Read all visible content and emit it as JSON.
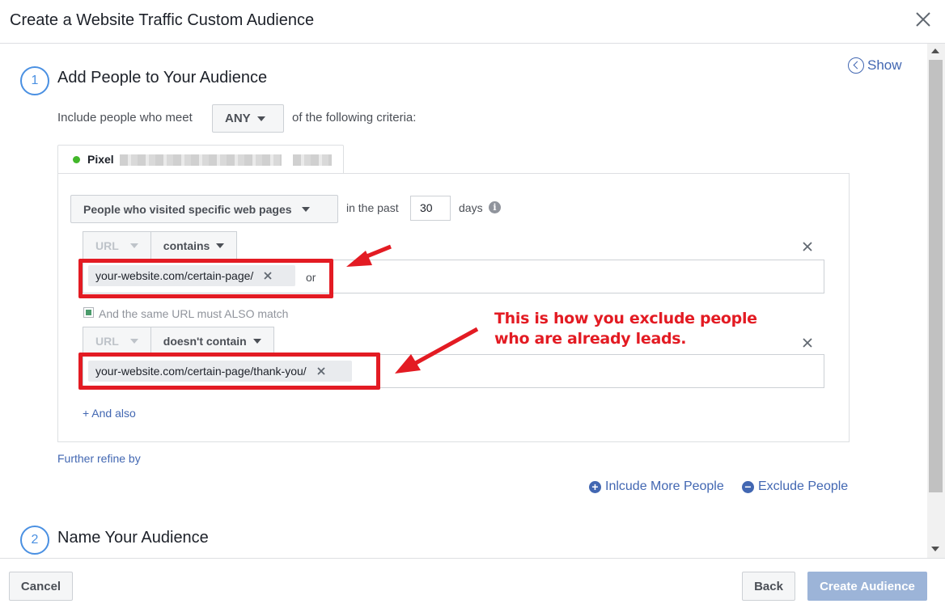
{
  "dialog": {
    "title": "Create a Website Traffic Custom Audience",
    "close_icon": "close-icon"
  },
  "step1": {
    "number": "1",
    "title": "Add People to Your Audience",
    "show_label": "Show",
    "include_prefix": "Include people who meet",
    "any_label": "ANY",
    "include_suffix": "of the following criteria:",
    "pixel_label": "Pixel",
    "event_dropdown": "People who visited specific web pages",
    "in_the_past": "in the past",
    "days_value": "30",
    "days_label": "days",
    "info_icon": "i",
    "rule1": {
      "field": "URL",
      "operator": "contains",
      "token": "your-website.com/certain-page/",
      "or_label": "or"
    },
    "also_match_label": "And the same URL must ALSO match",
    "rule2": {
      "field": "URL",
      "operator": "doesn't contain",
      "token": "your-website.com/certain-page/thank-you/"
    },
    "and_also": "+ And also",
    "further_refine": "Further refine by",
    "include_more": "Inlcude More People",
    "exclude": "Exclude People",
    "annotation_line1": "This is how you exclude people",
    "annotation_line2": "who are already leads."
  },
  "step2": {
    "number": "2",
    "title": "Name Your Audience"
  },
  "footer": {
    "cancel": "Cancel",
    "back": "Back",
    "create": "Create Audience"
  },
  "colors": {
    "accent": "#4267b2",
    "highlight": "#e31b23",
    "pixel_status": "#42b72a"
  }
}
